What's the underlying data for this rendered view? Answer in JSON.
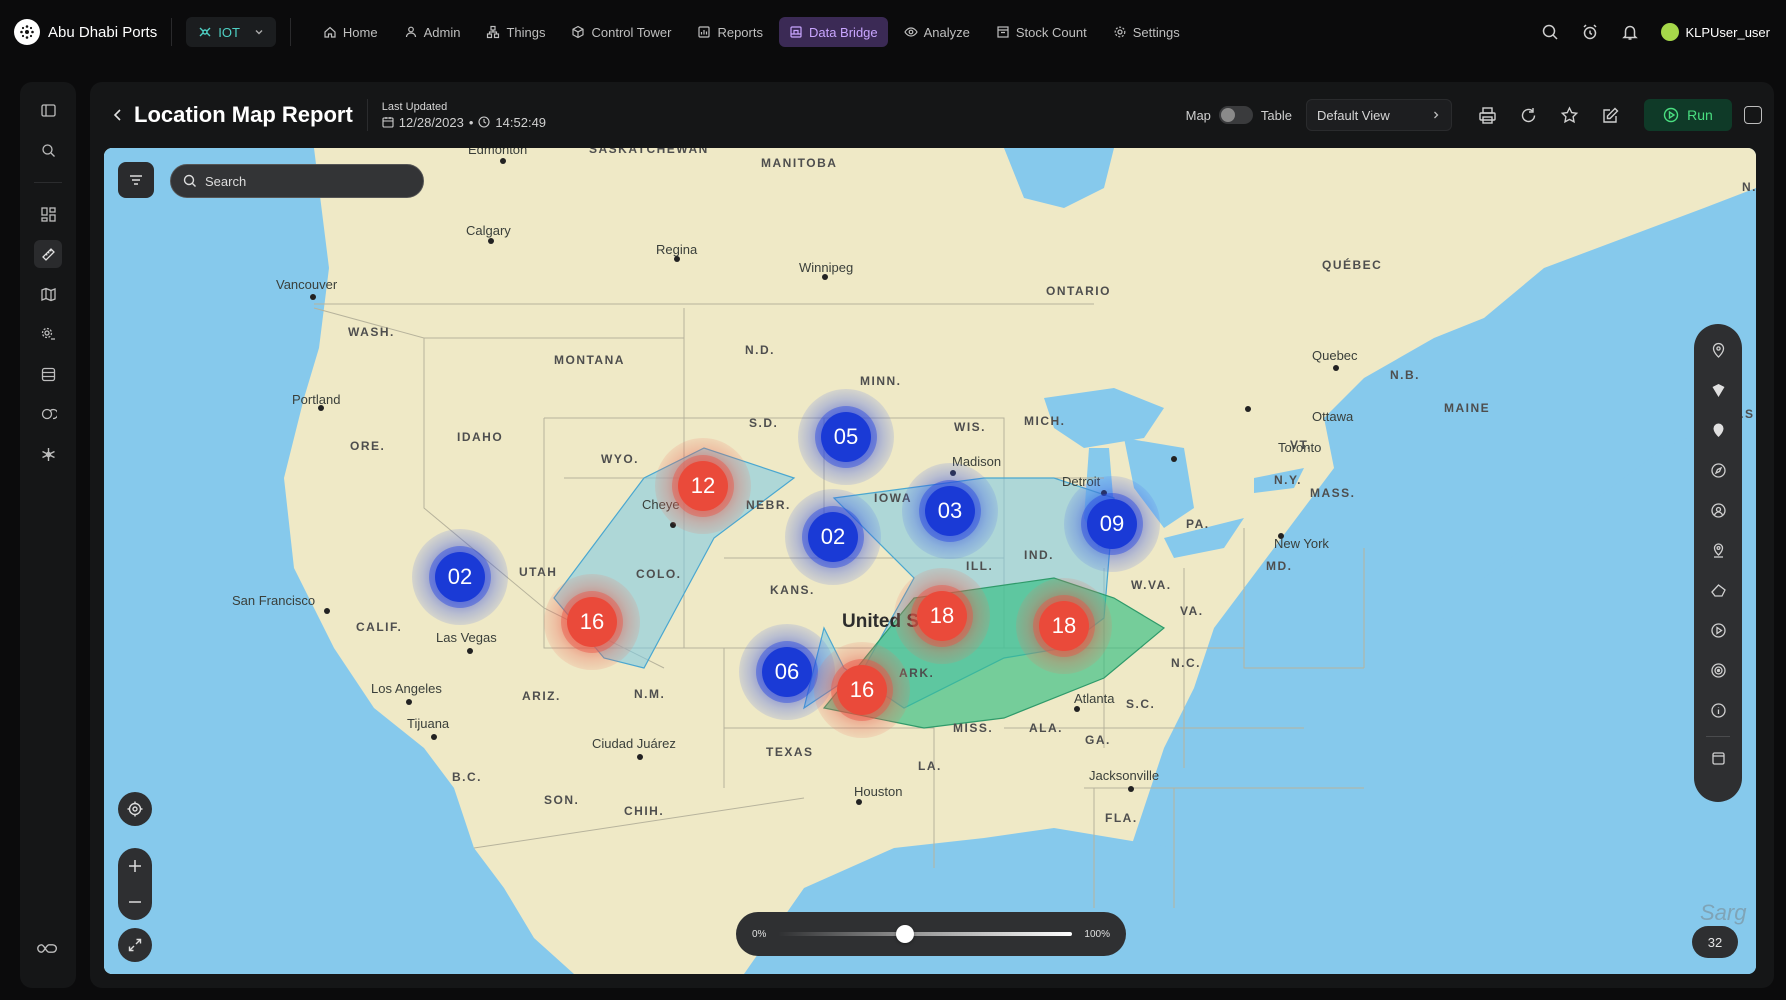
{
  "brand": {
    "name": "Abu Dhabi Ports"
  },
  "app_switcher": {
    "label": "IOT"
  },
  "nav": [
    {
      "label": "Home",
      "icon": "home-icon"
    },
    {
      "label": "Admin",
      "icon": "user-icon"
    },
    {
      "label": "Things",
      "icon": "things-icon"
    },
    {
      "label": "Control Tower",
      "icon": "cube-icon"
    },
    {
      "label": "Reports",
      "icon": "report-icon"
    },
    {
      "label": "Data Bridge",
      "icon": "data-bridge-icon",
      "active": true
    },
    {
      "label": "Analyze",
      "icon": "eye-icon"
    },
    {
      "label": "Stock Count",
      "icon": "box-icon"
    },
    {
      "label": "Settings",
      "icon": "gear-icon"
    }
  ],
  "user": {
    "name": "KLPUser_user"
  },
  "report": {
    "title": "Location Map Report",
    "last_updated_label": "Last Updated",
    "date": "12/28/2023",
    "time": "14:52:49",
    "toggle_left": "Map",
    "toggle_right": "Table",
    "view": "Default View",
    "run_label": "Run"
  },
  "search": {
    "placeholder": "Search"
  },
  "map": {
    "country": "United States",
    "regions": [
      {
        "t": "SASKATCHEWAN"
      },
      {
        "t": "MANITOBA"
      },
      {
        "t": "ONTARIO"
      },
      {
        "t": "QUÉBEC"
      },
      {
        "t": "WASH."
      },
      {
        "t": "MONTANA"
      },
      {
        "t": "N.D."
      },
      {
        "t": "MINN."
      },
      {
        "t": "ORE."
      },
      {
        "t": "IDAHO"
      },
      {
        "t": "WYO."
      },
      {
        "t": "S.D."
      },
      {
        "t": "WIS."
      },
      {
        "t": "MICH."
      },
      {
        "t": "NEBR."
      },
      {
        "t": "IOWA"
      },
      {
        "t": "UTAH"
      },
      {
        "t": "COLO."
      },
      {
        "t": "KANS."
      },
      {
        "t": "ILL."
      },
      {
        "t": "IND."
      },
      {
        "t": "PA."
      },
      {
        "t": "N.Y."
      },
      {
        "t": "VT."
      },
      {
        "t": "MASS."
      },
      {
        "t": "N.B."
      },
      {
        "t": "MAINE"
      },
      {
        "t": "CALIF."
      },
      {
        "t": "ARIZ."
      },
      {
        "t": "N.M."
      },
      {
        "t": "TEXAS"
      },
      {
        "t": "ARK."
      },
      {
        "t": "MISS."
      },
      {
        "t": "ALA."
      },
      {
        "t": "LA."
      },
      {
        "t": "GA."
      },
      {
        "t": "S.C."
      },
      {
        "t": "N.C."
      },
      {
        "t": "VA."
      },
      {
        "t": "W.VA."
      },
      {
        "t": "MD."
      },
      {
        "t": "FLA."
      },
      {
        "t": "B.C."
      },
      {
        "t": "SON."
      },
      {
        "t": "CHIH."
      },
      {
        "t": "N."
      },
      {
        "t": "N.S"
      }
    ],
    "cities": [
      {
        "t": "Edmonton"
      },
      {
        "t": "Calgary"
      },
      {
        "t": "Regina"
      },
      {
        "t": "Winnipeg"
      },
      {
        "t": "Vancouver"
      },
      {
        "t": "Portland"
      },
      {
        "t": "Quebec"
      },
      {
        "t": "Ottawa"
      },
      {
        "t": "Toronto"
      },
      {
        "t": "Detroit"
      },
      {
        "t": "Madison"
      },
      {
        "t": "New York"
      },
      {
        "t": "San Francisco"
      },
      {
        "t": "Las Vegas"
      },
      {
        "t": "Los Angeles"
      },
      {
        "t": "Tijuana"
      },
      {
        "t": "Ciudad Juárez"
      },
      {
        "t": "Houston"
      },
      {
        "t": "Atlanta"
      },
      {
        "t": "Jacksonville"
      },
      {
        "t": "Cheye"
      }
    ],
    "clusters": [
      {
        "label": "05",
        "color": "blue"
      },
      {
        "label": "12",
        "color": "red"
      },
      {
        "label": "03",
        "color": "blue"
      },
      {
        "label": "09",
        "color": "blue"
      },
      {
        "label": "02",
        "color": "blue"
      },
      {
        "label": "02",
        "color": "blue"
      },
      {
        "label": "16",
        "color": "red"
      },
      {
        "label": "18",
        "color": "red"
      },
      {
        "label": "18",
        "color": "red"
      },
      {
        "label": "06",
        "color": "blue"
      },
      {
        "label": "16",
        "color": "red"
      }
    ],
    "slider": {
      "min_label": "0%",
      "max_label": "100%",
      "value": 0.43
    },
    "count": "32",
    "watermark": "Sarg"
  },
  "colors": {
    "accent_purple": "#c9a6ff",
    "run_green": "#4ade80",
    "cluster_blue": "#1a3ad6",
    "cluster_red": "#ea4a3a"
  }
}
